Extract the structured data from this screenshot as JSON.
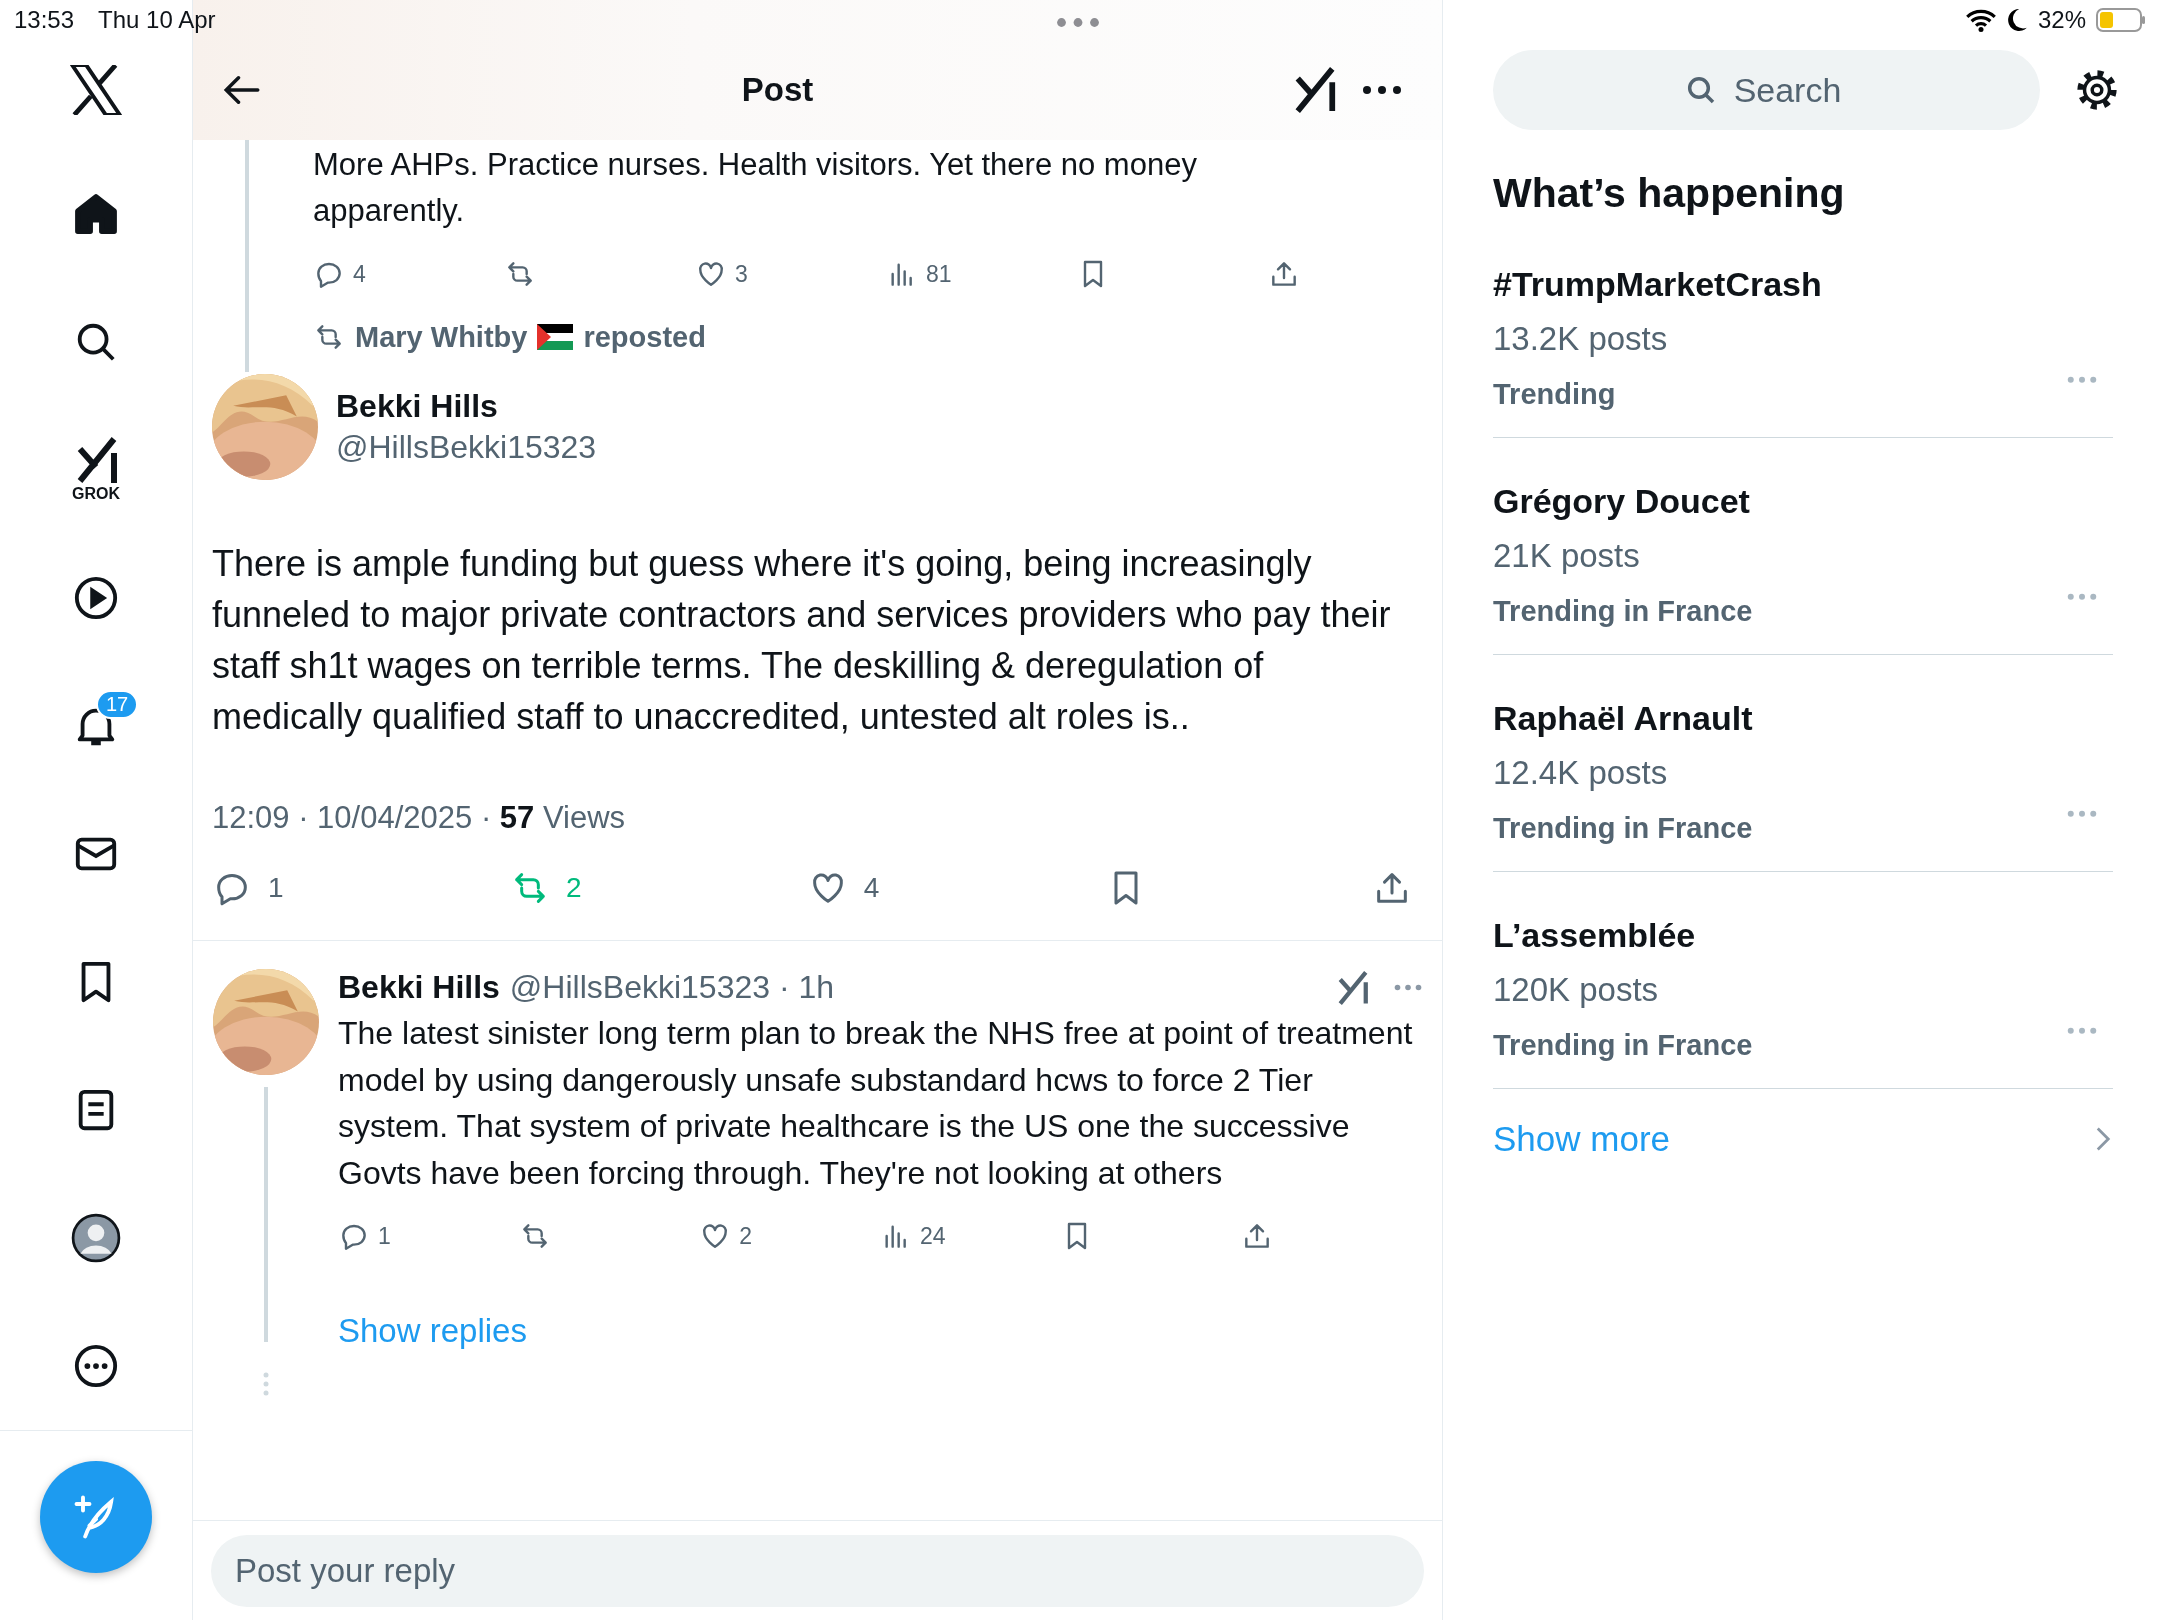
{
  "status_bar": {
    "time": "13:53",
    "date": "Thu 10 Apr",
    "battery": "32%"
  },
  "nav": [
    {
      "kind": "logo",
      "selected": false
    },
    {
      "kind": "home",
      "selected": true
    },
    {
      "kind": "search",
      "selected": false
    },
    {
      "kind": "grok",
      "label": "GROK",
      "selected": false
    },
    {
      "kind": "video",
      "selected": false
    },
    {
      "kind": "notifications",
      "badge": "17",
      "selected": false
    },
    {
      "kind": "messages",
      "selected": false
    },
    {
      "kind": "bookmarks",
      "selected": false
    },
    {
      "kind": "lists",
      "selected": false
    },
    {
      "kind": "profile",
      "selected": false
    },
    {
      "kind": "more",
      "selected": false
    }
  ],
  "header": {
    "title": "Post"
  },
  "previous_post": {
    "lines": [
      "More AHPs. Practice nurses. Health visitors. Yet there no money",
      "apparently."
    ],
    "actions": [
      {
        "kind": "reply",
        "count": "4",
        "active": false
      },
      {
        "kind": "repost",
        "active": false
      },
      {
        "kind": "like",
        "count": "3",
        "active": false
      },
      {
        "kind": "views",
        "count": "81",
        "active": false
      },
      {
        "kind": "bookmark",
        "active": false
      },
      {
        "kind": "share",
        "active": false
      }
    ]
  },
  "focused_post": {
    "reposted_by": "Mary Whitby",
    "reposted_label": "reposted",
    "name": "Bekki Hills",
    "handle": "@HillsBekki15323",
    "text": "There is ample funding but guess where it's going, being increasingly funneled to major private contractors and services providers who pay their staff sh1t wages on terrible terms. The deskilling & deregulation of medically qualified staff to unaccredited, untested alt roles is..",
    "meta": "12:09 · 10/04/2025 · **57** Views",
    "actions": [
      {
        "kind": "reply",
        "count": "1",
        "active": false
      },
      {
        "kind": "repost",
        "count": "2",
        "active": true
      },
      {
        "kind": "like",
        "count": "4",
        "active": false
      },
      {
        "kind": "bookmark",
        "active": false
      },
      {
        "kind": "share",
        "active": false
      }
    ]
  },
  "reply_post": {
    "name": "Bekki Hills",
    "meta": "@HillsBekki15323 · 1h",
    "text": "The latest sinister long term plan to break the NHS free at point of treatment  model by using dangerously unsafe substandard hcws to force 2 Tier system. That system of private healthcare is the US one the successive Govts have been forcing through. They're not looking at others",
    "actions": [
      {
        "kind": "reply",
        "count": "1",
        "active": false
      },
      {
        "kind": "repost",
        "active": false
      },
      {
        "kind": "like",
        "count": "2",
        "active": false
      },
      {
        "kind": "views",
        "count": "24",
        "active": false
      },
      {
        "kind": "bookmark",
        "active": false
      },
      {
        "kind": "share",
        "active": false
      }
    ],
    "show_replies": "Show replies"
  },
  "reply_field": {
    "placeholder": "Post your reply"
  },
  "search": {
    "placeholder": "Search"
  },
  "trends_title": "What’s happening",
  "trends": [
    {
      "title": "#TrumpMarketCrash",
      "count": "13.2K posts",
      "context": "Trending"
    },
    {
      "title": "Grégory Doucet",
      "count": "21K posts",
      "context": "Trending in France"
    },
    {
      "title": "Raphaël Arnault",
      "count": "12.4K posts",
      "context": "Trending in France"
    },
    {
      "title": "L’assemblée",
      "count": "120K posts",
      "context": "Trending in France"
    }
  ],
  "show_more": "Show more"
}
